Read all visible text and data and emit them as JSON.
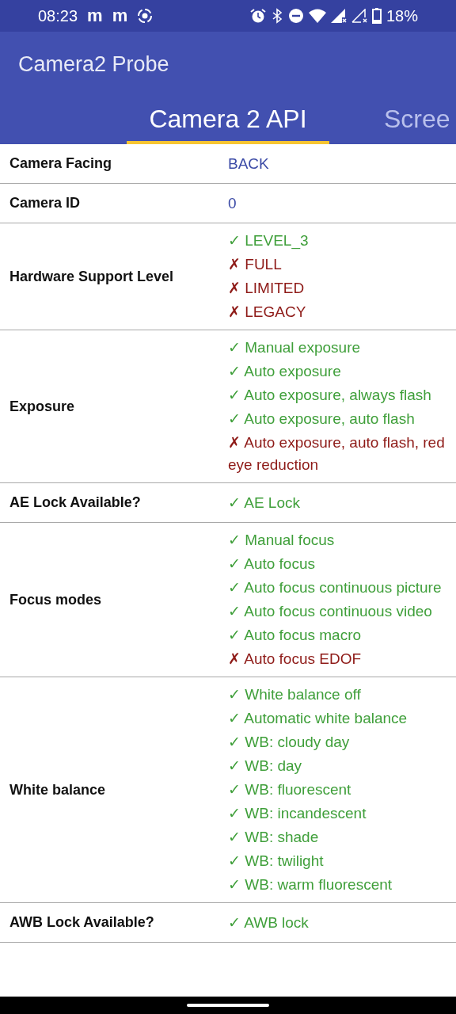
{
  "status_bar": {
    "time": "08:23",
    "notifications": [
      "m",
      "m"
    ],
    "battery": "18%"
  },
  "app_bar": {
    "title": "Camera2 Probe"
  },
  "tabs": [
    {
      "label": "Camera 2 API",
      "selected": true
    },
    {
      "label": "Scree",
      "selected": false
    }
  ],
  "rows": [
    {
      "label": "Camera Facing",
      "kind": "plain",
      "value": "BACK"
    },
    {
      "label": "Camera ID",
      "kind": "plain",
      "value": "0"
    },
    {
      "label": "Hardware Support Level",
      "kind": "list",
      "items": [
        {
          "text": "✓ LEVEL_3",
          "supported": true
        },
        {
          "text": "✗ FULL",
          "supported": false
        },
        {
          "text": "✗ LIMITED",
          "supported": false
        },
        {
          "text": "✗ LEGACY",
          "supported": false
        }
      ]
    },
    {
      "label": "Exposure",
      "kind": "list",
      "items": [
        {
          "text": "✓ Manual exposure",
          "supported": true
        },
        {
          "text": "✓ Auto exposure",
          "supported": true
        },
        {
          "text": "✓ Auto exposure, always flash",
          "supported": true
        },
        {
          "text": "✓ Auto exposure, auto flash",
          "supported": true
        },
        {
          "text": "✗ Auto exposure, auto flash, red eye reduction",
          "supported": false
        }
      ]
    },
    {
      "label": "AE Lock Available?",
      "kind": "list",
      "items": [
        {
          "text": "✓ AE Lock",
          "supported": true
        }
      ]
    },
    {
      "label": "Focus modes",
      "kind": "list",
      "items": [
        {
          "text": "✓ Manual focus",
          "supported": true
        },
        {
          "text": "✓ Auto focus",
          "supported": true
        },
        {
          "text": "✓ Auto focus continuous picture",
          "supported": true
        },
        {
          "text": "✓ Auto focus continuous video",
          "supported": true
        },
        {
          "text": "✓ Auto focus macro",
          "supported": true
        },
        {
          "text": "✗ Auto focus EDOF",
          "supported": false
        }
      ]
    },
    {
      "label": "White balance",
      "kind": "list",
      "items": [
        {
          "text": "✓ White balance off",
          "supported": true
        },
        {
          "text": "✓ Automatic white balance",
          "supported": true
        },
        {
          "text": "✓ WB: cloudy day",
          "supported": true
        },
        {
          "text": "✓ WB: day",
          "supported": true
        },
        {
          "text": "✓ WB: fluorescent",
          "supported": true
        },
        {
          "text": "✓ WB: incandescent",
          "supported": true
        },
        {
          "text": "✓ WB: shade",
          "supported": true
        },
        {
          "text": "✓ WB: twilight",
          "supported": true
        },
        {
          "text": "✓ WB: warm fluorescent",
          "supported": true
        }
      ]
    },
    {
      "label": "AWB Lock Available?",
      "kind": "list",
      "items": [
        {
          "text": "✓ AWB lock",
          "supported": true
        }
      ]
    }
  ]
}
